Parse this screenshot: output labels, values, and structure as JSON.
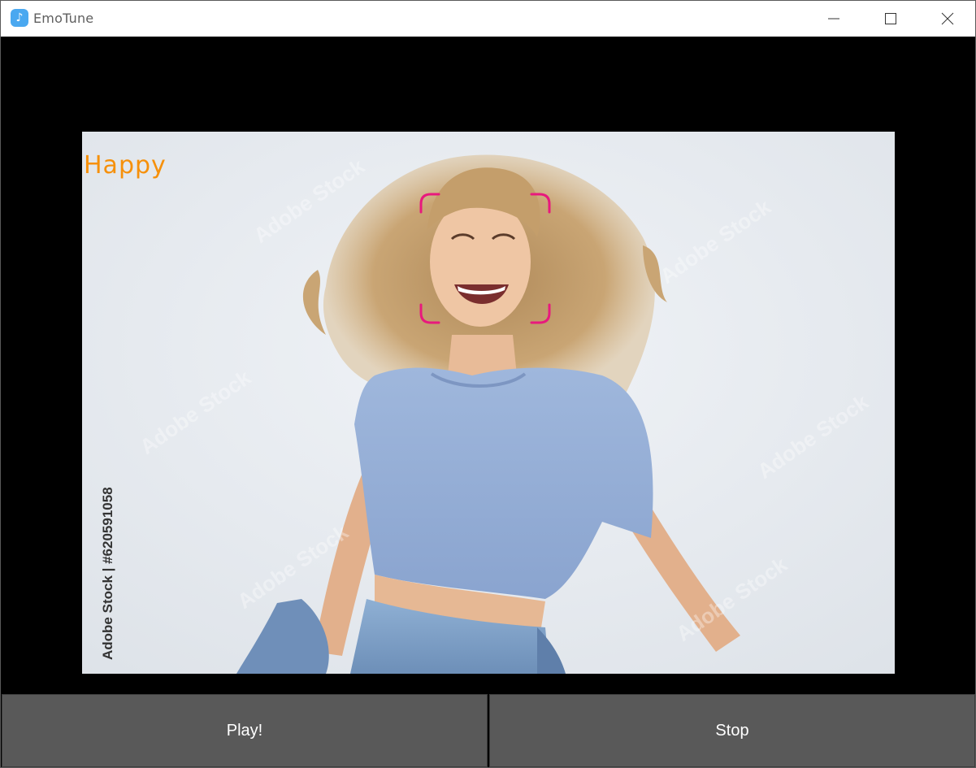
{
  "window": {
    "title": "EmoTune",
    "app_icon": "music-note-icon",
    "controls": [
      "minimize-icon",
      "maximize-icon",
      "close-icon"
    ]
  },
  "camera": {
    "emotion_label": "Happy",
    "emotion_color": "#f6900a",
    "face_box_color": "#e8197d",
    "image_credit": "Adobe Stock | #620591058",
    "watermark_text": "Adobe Stock"
  },
  "buttons": {
    "play_label": "Play!",
    "stop_label": "Stop"
  }
}
